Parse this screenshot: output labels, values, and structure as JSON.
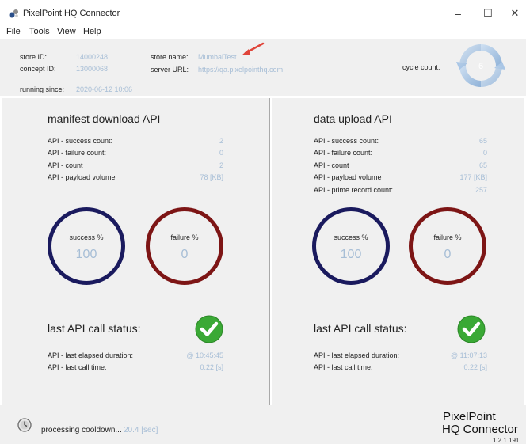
{
  "window": {
    "title": "PixelPoint HQ Connector",
    "minimize_glyph": "–",
    "maximize_glyph": "☐",
    "close_glyph": "✕"
  },
  "menu": [
    "File",
    "Tools",
    "View",
    "Help"
  ],
  "header": {
    "store_id_label": "store ID:",
    "store_id": "14000248",
    "concept_id_label": "concept ID:",
    "concept_id": "13000068",
    "running_since_label": "running since:",
    "running_since": "2020-06-12 10:06",
    "store_name_label": "store name:",
    "store_name": "MumbaiTest",
    "server_url_label": "server URL:",
    "server_url": "https://qa.pixelpointhq.com",
    "cycle_count_label": "cycle count:",
    "cycle_count": "6"
  },
  "manifest": {
    "title": "manifest download API",
    "stats": [
      {
        "label": "API  - success count:",
        "value": "2"
      },
      {
        "label": "API  - failure count:",
        "value": "0"
      },
      {
        "label": "API  - count",
        "value": "2"
      },
      {
        "label": "API  - payload volume",
        "value": "78 [KB]"
      }
    ],
    "success_label": "success %",
    "success_value": "100",
    "failure_label": "failure %",
    "failure_value": "0",
    "status_title": "last API call status:",
    "status_rows": [
      {
        "label": "API  - last elapsed duration:",
        "value": "@ 10:45:45"
      },
      {
        "label": "API  - last call time:",
        "value": "0.22 [s]"
      }
    ]
  },
  "upload": {
    "title": "data upload API",
    "stats": [
      {
        "label": "API  - success count:",
        "value": "65"
      },
      {
        "label": "API  - failure count:",
        "value": "0"
      },
      {
        "label": "API  - count",
        "value": "65"
      },
      {
        "label": "API  - payload volume",
        "value": "177 [KB]"
      },
      {
        "label": "API  - prime record count:",
        "value": "257"
      }
    ],
    "success_label": "success %",
    "success_value": "100",
    "failure_label": "failure %",
    "failure_value": "0",
    "status_title": "last API call status:",
    "status_rows": [
      {
        "label": "API  - last elapsed duration:",
        "value": "@ 11:07:13"
      },
      {
        "label": "API  - last call time:",
        "value": "0.22 [s]"
      }
    ]
  },
  "footer": {
    "processing_label": "processing cooldown...",
    "processing_value": "20.4 [sec]",
    "brand_line1": "PixelPoint",
    "brand_line2": "HQ Connector",
    "version": "1.2.1.191"
  },
  "colors": {
    "value_text": "#a7bed6",
    "success_ring": "#1a1a5e",
    "failure_ring": "#7d1515",
    "check_green": "#3aa935"
  },
  "icons": [
    "app-icon",
    "red-arrow-icon",
    "cycle-arrows-icon",
    "check-icon",
    "clock-icon"
  ]
}
